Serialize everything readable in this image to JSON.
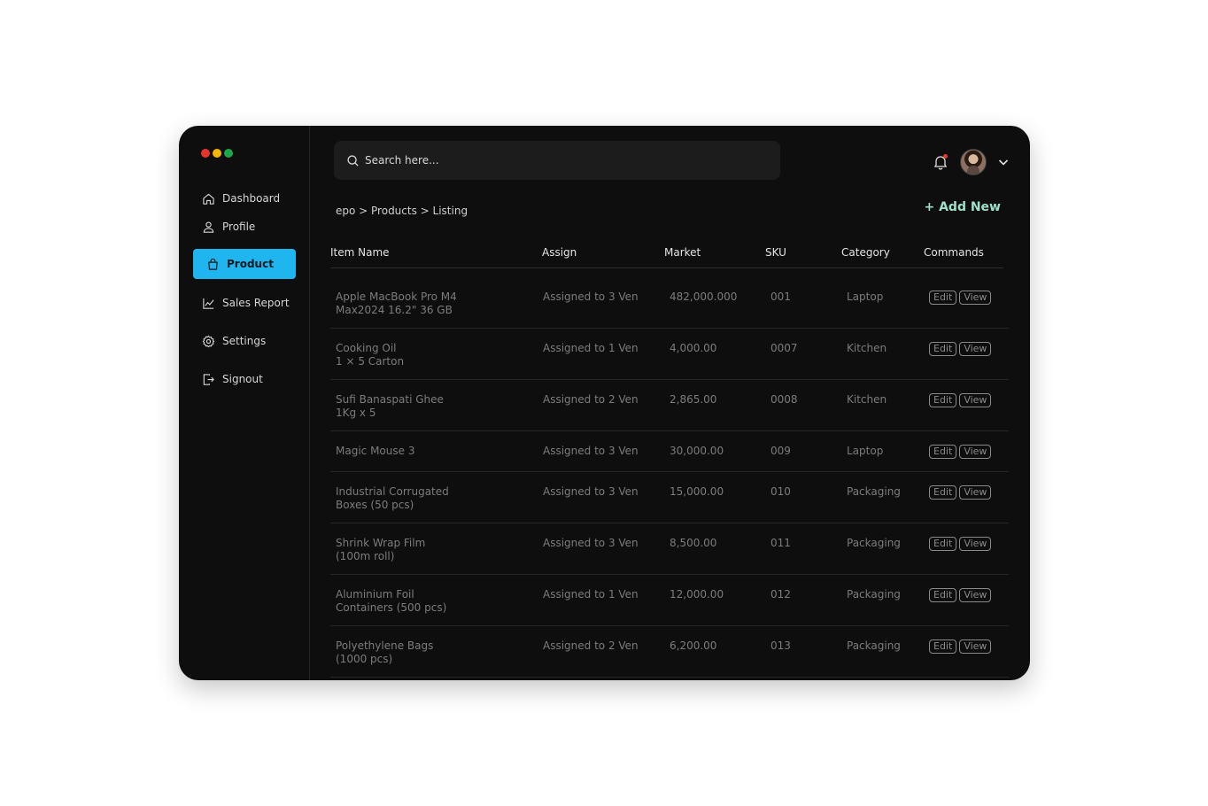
{
  "window": {
    "traffic_lights": [
      "#e8352c",
      "#f2b705",
      "#1ea84c"
    ]
  },
  "sidebar": {
    "items": [
      {
        "label": "Dashboard",
        "icon": "home-icon",
        "active": false
      },
      {
        "label": "Profile",
        "icon": "user-icon",
        "active": false
      },
      {
        "label": "Product",
        "icon": "bag-icon",
        "active": true
      },
      {
        "label": "Sales Report",
        "icon": "chart-icon",
        "active": false
      },
      {
        "label": "Settings",
        "icon": "gear-icon",
        "active": false
      },
      {
        "label": "Signout",
        "icon": "signout-icon",
        "active": false
      }
    ],
    "accent": "#1fb6ef"
  },
  "header": {
    "search_placeholder": "Search here...",
    "add_new_label": "+ Add New"
  },
  "breadcrumb": "epo > Products > Listing",
  "table": {
    "columns": [
      "Item Name",
      "Assign",
      "Market",
      "SKU",
      "Category",
      "Commands"
    ],
    "edit_label": "Edit",
    "view_label": "View",
    "rows": [
      {
        "name1": "Apple MacBook Pro M4",
        "name2": "Max2024 16.2\" 36 GB",
        "assign": "Assigned to 3 Ven",
        "market": "482,000.000",
        "sku": "001",
        "category": "Laptop"
      },
      {
        "name1": "Cooking Oil",
        "name2": "1 × 5 Carton",
        "assign": "Assigned to 1 Ven",
        "market": "4,000.00",
        "sku": "0007",
        "category": "Kitchen"
      },
      {
        "name1": "Sufi Banaspati Ghee",
        "name2": "1Kg x 5",
        "assign": "Assigned to 2 Ven",
        "market": "2,865.00",
        "sku": "0008",
        "category": "Kitchen"
      },
      {
        "name1": "Magic Mouse 3",
        "name2": "",
        "assign": "Assigned to 3 Ven",
        "market": "30,000.00",
        "sku": "009",
        "category": "Laptop"
      },
      {
        "name1": "Industrial Corrugated",
        "name2": "Boxes (50 pcs)",
        "assign": "Assigned to 3 Ven",
        "market": "15,000.00",
        "sku": "010",
        "category": "Packaging"
      },
      {
        "name1": "Shrink Wrap Film",
        "name2": "(100m roll)",
        "assign": "Assigned to 3 Ven",
        "market": "8,500.00",
        "sku": "011",
        "category": "Packaging"
      },
      {
        "name1": "Aluminium Foil",
        "name2": "Containers (500 pcs)",
        "assign": "Assigned to 1 Ven",
        "market": "12,000.00",
        "sku": "012",
        "category": "Packaging"
      },
      {
        "name1": "Polyethylene Bags",
        "name2": "(1000 pcs)",
        "assign": "Assigned to 2 Ven",
        "market": "6,200.00",
        "sku": "013",
        "category": "Packaging"
      }
    ]
  }
}
